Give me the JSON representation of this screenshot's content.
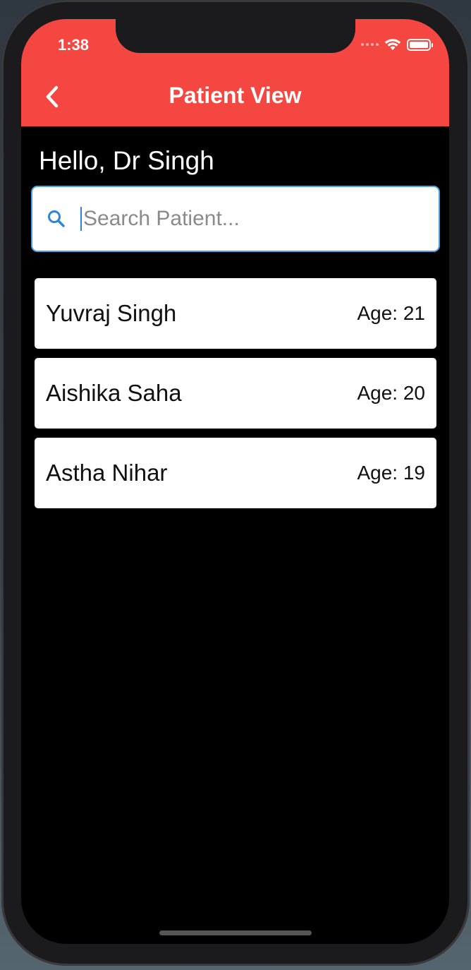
{
  "status_bar": {
    "time": "1:38",
    "icons": [
      "signal-icon",
      "wifi-icon",
      "battery-icon"
    ]
  },
  "header": {
    "title": "Patient View",
    "back_icon": "chevron-left-icon"
  },
  "greeting": "Hello, Dr Singh",
  "search": {
    "placeholder": "Search Patient...",
    "value": "",
    "icon": "search-icon"
  },
  "patients": [
    {
      "name": "Yuvraj Singh",
      "age": "Age: 21"
    },
    {
      "name": "Aishika Saha",
      "age": "Age: 20"
    },
    {
      "name": "Astha Nihar",
      "age": "Age: 19"
    }
  ],
  "colors": {
    "accent": "#f44741",
    "background": "#000000",
    "search_border": "#4ea1e0",
    "search_icon": "#2f86d9"
  }
}
